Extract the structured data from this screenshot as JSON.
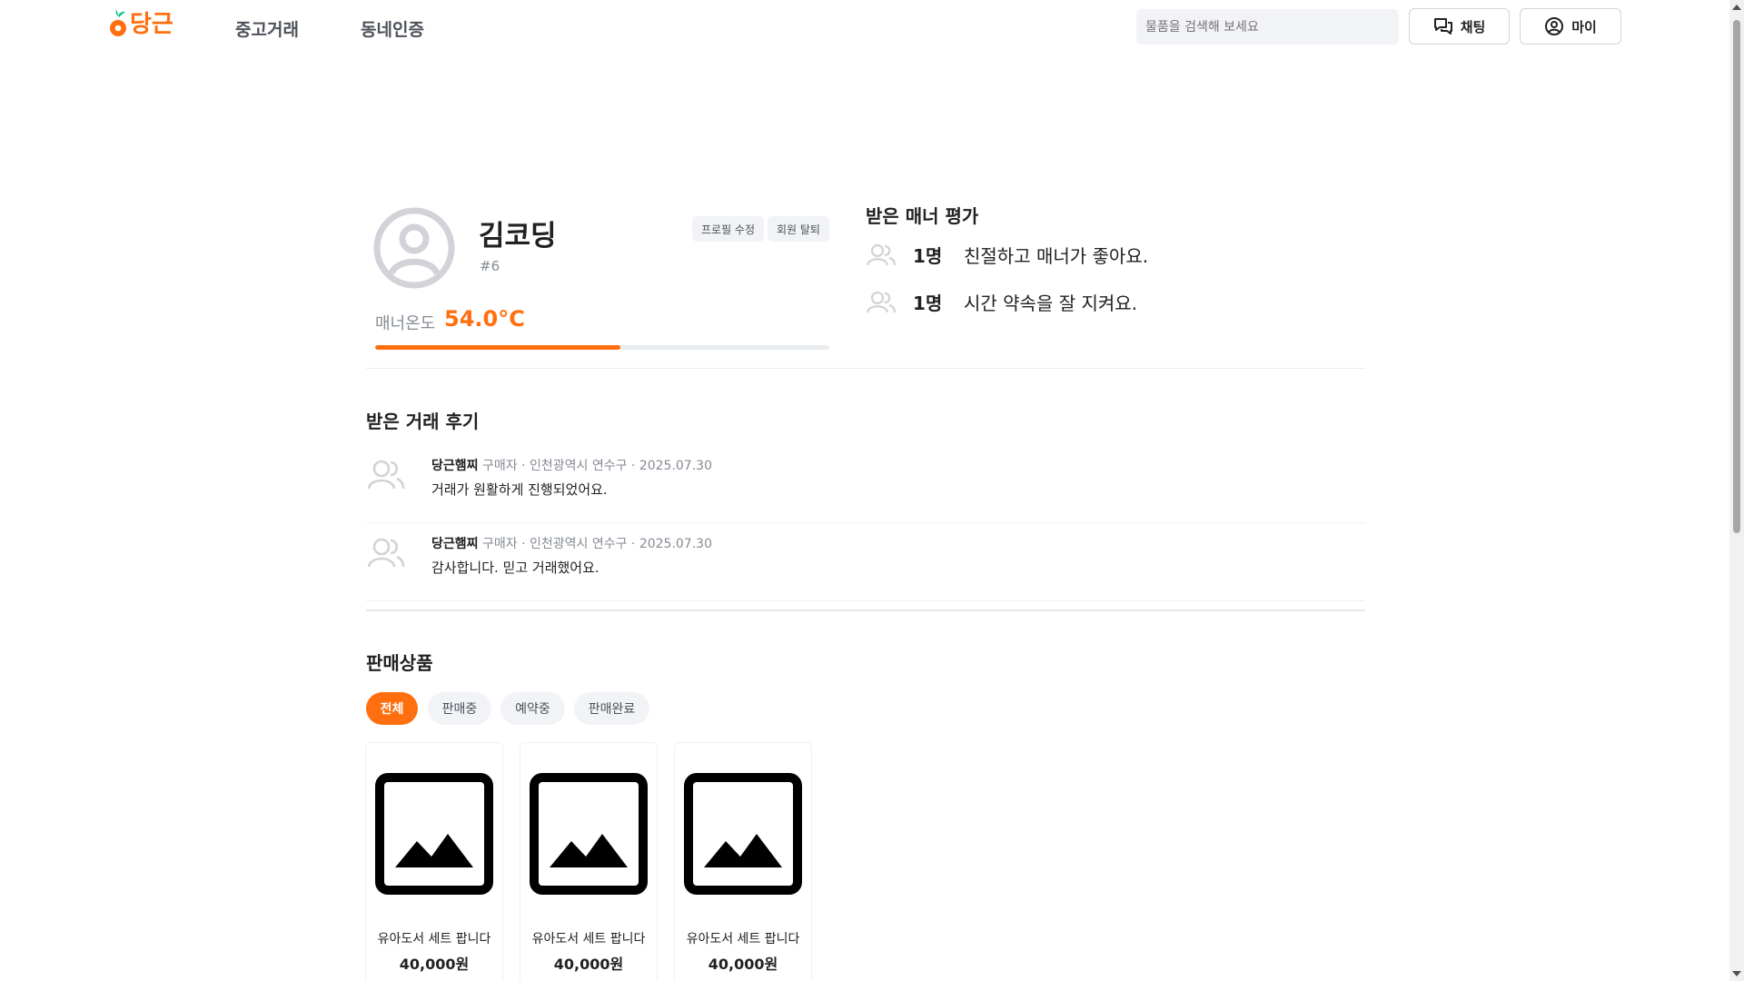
{
  "header": {
    "logo_text": "당근",
    "nav": [
      "중고거래",
      "동네인증"
    ],
    "search_placeholder": "물품을 검색해 보세요",
    "chat_label": "채팅",
    "my_label": "마이"
  },
  "profile": {
    "name": "김코딩",
    "id": "#6",
    "edit_label": "프로필 수정",
    "withdraw_label": "회원 탈퇴",
    "temp_label": "매너온도",
    "temp_value": "54.0°C",
    "temp_fraction": 0.54
  },
  "manner": {
    "title": "받은 매너 평가",
    "items": [
      {
        "count": "1명",
        "text": "친절하고 매너가 좋아요."
      },
      {
        "count": "1명",
        "text": "시간 약속을 잘 지켜요."
      }
    ]
  },
  "reviews": {
    "title": "받은 거래 후기",
    "items": [
      {
        "author": "당근햄찌",
        "meta": "구매자 · 인천광역시 연수구 · 2025.07.30",
        "text": "거래가 원활하게 진행되었어요."
      },
      {
        "author": "당근햄찌",
        "meta": "구매자 · 인천광역시 연수구 · 2025.07.30",
        "text": "감사합니다. 믿고 거래했어요."
      }
    ]
  },
  "products": {
    "title": "판매상품",
    "filters": [
      "전체",
      "판매중",
      "예약중",
      "판매완료"
    ],
    "active_filter": "전체",
    "items": [
      {
        "title": "유아도서 세트 팝니다",
        "price": "40,000원"
      },
      {
        "title": "유아도서 세트 팝니다",
        "price": "40,000원"
      },
      {
        "title": "유아도서 세트 팝니다",
        "price": "40,000원"
      }
    ]
  },
  "colors": {
    "brand": "#ff6f0f"
  }
}
